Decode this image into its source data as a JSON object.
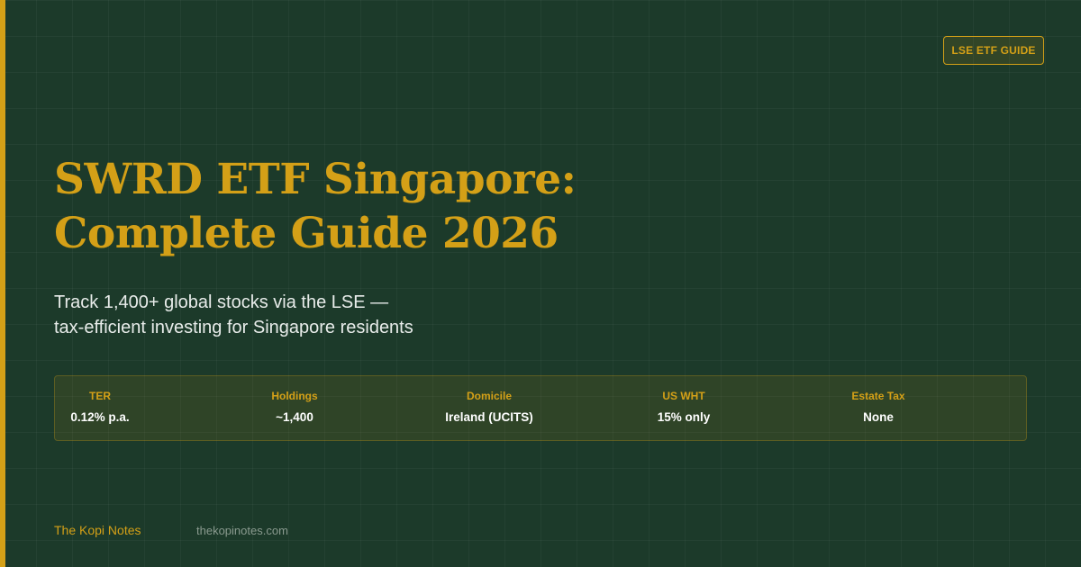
{
  "badge": "LSE ETF GUIDE",
  "title": {
    "line1": "SWRD ETF Singapore:",
    "line2": "Complete Guide 2026"
  },
  "subtitle": {
    "line1": "Track 1,400+ global stocks via the LSE —",
    "line2": "tax-efficient investing for Singapore residents"
  },
  "stats": [
    {
      "label": "TER",
      "value": "0.12% p.a."
    },
    {
      "label": "Holdings",
      "value": "~1,400"
    },
    {
      "label": "Domicile",
      "value": "Ireland (UCITS)"
    },
    {
      "label": "US WHT",
      "value": "15% only"
    },
    {
      "label": "Estate Tax",
      "value": "None"
    }
  ],
  "footer": {
    "brand": "The Kopi Notes",
    "site": "thekopinotes.com"
  },
  "colors": {
    "background": "#1c3a2a",
    "accent": "#d4a017",
    "text": "#e8ecea",
    "muted": "#8a9a8f"
  }
}
